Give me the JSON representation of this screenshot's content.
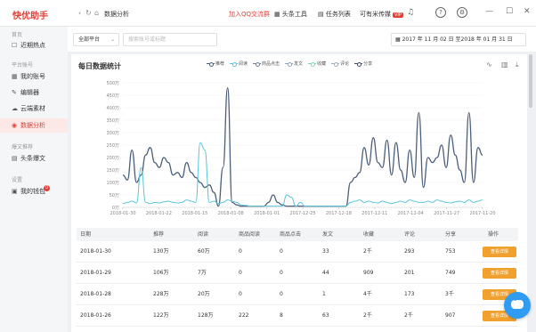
{
  "app": {
    "name": "快优助手",
    "page_title": "数据分析"
  },
  "topbar": {
    "qq_link": "加入QQ交流群",
    "toutiao_tool": "头条工具",
    "task_list": "任务列表",
    "hot_rank": "可有米传媒",
    "vip_badge": "VIP"
  },
  "colors": {
    "brand": "#e0413a",
    "primary_line": "#4c5f7a",
    "secondary_line": "#5bc4d9",
    "action": "#f0a12d"
  },
  "sidebar": {
    "sections": [
      {
        "label": "首页"
      },
      {
        "label": "平台账号"
      },
      {
        "label": "爆文推荐"
      },
      {
        "label": "设置"
      }
    ],
    "items": [
      {
        "label": "近期热点",
        "icon": "edit-icon"
      },
      {
        "label": "我的账号",
        "icon": "grid-icon"
      },
      {
        "label": "编辑器",
        "icon": "pencil-icon"
      },
      {
        "label": "云端素材",
        "icon": "cloud-icon"
      },
      {
        "label": "数据分析",
        "icon": "eye-icon"
      },
      {
        "label": "头条爆文",
        "icon": "document-icon"
      },
      {
        "label": "我的钱包",
        "icon": "wallet-icon",
        "badge": "0"
      }
    ]
  },
  "filters": {
    "platform": "全部平台",
    "search_placeholder": "搜索账号或标题",
    "date_range": "2017 年 11 月 02 日 至2018 年 01 月 31 日"
  },
  "card": {
    "title": "每日数据统计"
  },
  "chart_data": {
    "type": "line",
    "title": "每日数据统计",
    "ylim": [
      0,
      500
    ],
    "yticks": [
      "0万",
      "50万",
      "100万",
      "150万",
      "200万",
      "250万",
      "300万",
      "350万",
      "400万",
      "450万",
      "500万"
    ],
    "xticks": [
      "2018-01-30",
      "2018-01-22",
      "2018-01-15",
      "2018-01-08",
      "2018-01-01",
      "2017-12-25",
      "2017-12-18",
      "2017-12-11",
      "2017-12-04",
      "2017-11-27",
      "2017-11-20"
    ],
    "legend": [
      "推荐",
      "阅读",
      "商品点击",
      "发文",
      "收藏",
      "评论",
      "分享"
    ],
    "legend_colors": [
      "#4c5f7a",
      "#5bc4d9",
      "#6f7f99",
      "#8fa4c4",
      "#7fd2c7",
      "#a0aebe",
      "#3d4a5e"
    ],
    "series": [
      {
        "name": "推荐",
        "values": [
          130,
          110,
          230,
          100,
          130,
          210,
          240,
          180,
          160,
          200,
          180,
          130,
          140,
          120,
          180,
          140,
          120,
          100,
          80,
          90,
          60,
          5,
          160,
          480,
          20,
          10,
          5,
          5,
          5,
          5,
          5,
          5,
          20,
          50,
          20,
          10,
          5,
          5,
          5,
          5,
          5,
          5,
          5,
          5,
          5,
          5,
          5,
          5,
          5,
          5,
          100,
          120,
          140,
          240,
          170,
          280,
          180,
          160,
          270,
          130,
          260,
          150,
          100,
          230,
          120,
          380,
          80,
          200,
          180,
          200,
          250,
          160,
          290,
          210,
          150,
          100,
          380,
          100,
          240,
          210
        ]
      },
      {
        "name": "阅读",
        "values": [
          15,
          20,
          25,
          18,
          160,
          20,
          15,
          20,
          18,
          22,
          25,
          20,
          18,
          20,
          30,
          25,
          20,
          260,
          230,
          20,
          25,
          15,
          20,
          30,
          25,
          20,
          10,
          8,
          5,
          5,
          5,
          5,
          5,
          5,
          5,
          5,
          50,
          40,
          5,
          20,
          5,
          5,
          5,
          5,
          5,
          5,
          5,
          5,
          5,
          5,
          20,
          25,
          30,
          20,
          25,
          20,
          18,
          25,
          20,
          15,
          20,
          25,
          20,
          30,
          25,
          20,
          20,
          25,
          20,
          30,
          25,
          20,
          18,
          22,
          25,
          20,
          30,
          20,
          25,
          30
        ]
      }
    ]
  },
  "table": {
    "headers": [
      "日期",
      "推荐",
      "阅读",
      "商品阅读",
      "商品点击",
      "发文",
      "收藏",
      "评论",
      "分享",
      "操作"
    ],
    "rows": [
      {
        "date": "2018-01-30",
        "rec": "130万",
        "read": "60万",
        "gread": "0",
        "gclick": "0",
        "posts": "33",
        "fav": "2千",
        "comm": "293",
        "share": "753",
        "action": "查看详情"
      },
      {
        "date": "2018-01-29",
        "rec": "106万",
        "read": "7万",
        "gread": "0",
        "gclick": "0",
        "posts": "44",
        "fav": "909",
        "comm": "201",
        "share": "749",
        "action": "查看详情"
      },
      {
        "date": "2018-01-28",
        "rec": "228万",
        "read": "20万",
        "gread": "0",
        "gclick": "0",
        "posts": "1",
        "fav": "4千",
        "comm": "173",
        "share": "3千",
        "action": "查看详情"
      },
      {
        "date": "2018-01-26",
        "rec": "122万",
        "read": "128万",
        "gread": "222",
        "gclick": "8",
        "posts": "63",
        "fav": "2千",
        "comm": "2千",
        "share": "907",
        "action": "查看详情"
      }
    ]
  }
}
